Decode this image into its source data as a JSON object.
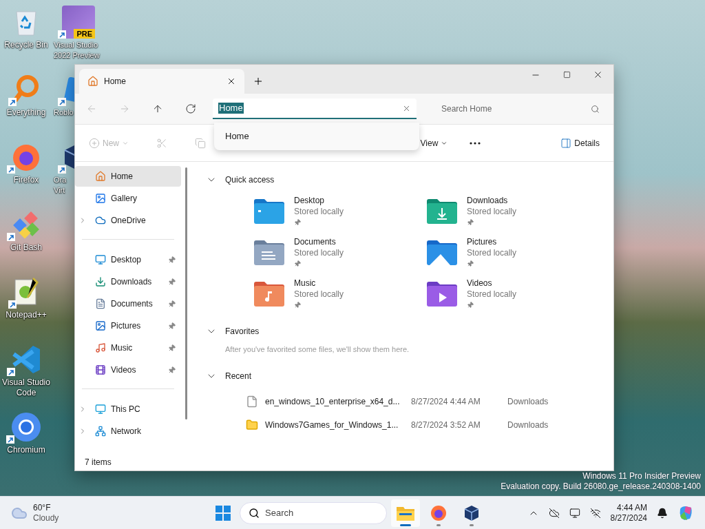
{
  "desktop_icons": [
    {
      "kind": "recycle",
      "lines": [
        "Recycle Bin"
      ],
      "shortcut": false
    },
    {
      "kind": "everything",
      "lines": [
        "Everything"
      ],
      "shortcut": true
    },
    {
      "kind": "firefox",
      "lines": [
        "Firefox"
      ],
      "shortcut": true
    },
    {
      "kind": "gitbash",
      "lines": [
        "Git Bash"
      ],
      "shortcut": true
    },
    {
      "kind": "notepad",
      "lines": [
        "Notepad++"
      ],
      "shortcut": true
    },
    {
      "kind": "vscode",
      "lines": [
        "Visual Studio",
        "Code"
      ],
      "shortcut": true
    },
    {
      "kind": "chromium",
      "lines": [
        "Chromium"
      ],
      "shortcut": true
    },
    {
      "kind": "vs",
      "lines": [
        "Visual Studio",
        "2022 Preview"
      ],
      "shortcut": true,
      "badge": "PRE"
    },
    {
      "kind": "roblox",
      "lines": [
        "Roblo"
      ],
      "shortcut": true
    },
    {
      "kind": "virtualbox",
      "lines": [
        "Ora",
        "Virt"
      ],
      "shortcut": true
    }
  ],
  "explorer": {
    "tab": {
      "title": "Home"
    },
    "nav": [
      {
        "kind": "back",
        "disabled": true
      },
      {
        "kind": "forward",
        "disabled": true
      },
      {
        "kind": "up",
        "disabled": false
      },
      {
        "kind": "refresh",
        "disabled": false
      }
    ],
    "address": {
      "value": "Home",
      "suggestions": [
        "Home"
      ]
    },
    "search": {
      "placeholder": "Search Home"
    },
    "toolbar": [
      {
        "kind": "new",
        "label": "New",
        "disabled": true
      },
      {
        "kind": "cut",
        "disabled": true
      },
      {
        "kind": "copy",
        "disabled": true
      },
      {
        "kind": "view",
        "label": "View",
        "disabled": false
      },
      {
        "kind": "more",
        "disabled": false
      },
      {
        "kind": "details",
        "label": "Details",
        "disabled": false
      }
    ],
    "sidebar": {
      "groups": [
        [
          {
            "kind": "home",
            "label": "Home",
            "selected": true,
            "pinned": false,
            "expandable": false
          },
          {
            "kind": "gallery",
            "label": "Gallery",
            "selected": false,
            "pinned": false,
            "expandable": false
          },
          {
            "kind": "onedrive",
            "label": "OneDrive",
            "selected": false,
            "pinned": false,
            "expandable": true
          }
        ],
        [
          {
            "kind": "desktop",
            "label": "Desktop",
            "selected": false,
            "pinned": true,
            "expandable": false
          },
          {
            "kind": "downloads",
            "label": "Downloads",
            "selected": false,
            "pinned": true,
            "expandable": false
          },
          {
            "kind": "documents",
            "label": "Documents",
            "selected": false,
            "pinned": true,
            "expandable": false
          },
          {
            "kind": "pictures",
            "label": "Pictures",
            "selected": false,
            "pinned": true,
            "expandable": false
          },
          {
            "kind": "music",
            "label": "Music",
            "selected": false,
            "pinned": true,
            "expandable": false
          },
          {
            "kind": "videos",
            "label": "Videos",
            "selected": false,
            "pinned": true,
            "expandable": false
          }
        ],
        [
          {
            "kind": "thispc",
            "label": "This PC",
            "selected": false,
            "pinned": false,
            "expandable": true
          },
          {
            "kind": "network",
            "label": "Network",
            "selected": false,
            "pinned": false,
            "expandable": true
          }
        ]
      ]
    },
    "quick_access": {
      "title": "Quick access",
      "expanded": true,
      "items": [
        {
          "kind": "desktop",
          "name": "Desktop",
          "status": "Stored locally",
          "pinned": true
        },
        {
          "kind": "downloads",
          "name": "Downloads",
          "status": "Stored locally",
          "pinned": true
        },
        {
          "kind": "documents",
          "name": "Documents",
          "status": "Stored locally",
          "pinned": true
        },
        {
          "kind": "pictures",
          "name": "Pictures",
          "status": "Stored locally",
          "pinned": true
        },
        {
          "kind": "music",
          "name": "Music",
          "status": "Stored locally",
          "pinned": true
        },
        {
          "kind": "videos",
          "name": "Videos",
          "status": "Stored locally",
          "pinned": true
        }
      ]
    },
    "favorites": {
      "title": "Favorites",
      "expanded": true,
      "hint": "After you've favorited some files, we'll show them here."
    },
    "recent": {
      "title": "Recent",
      "expanded": true,
      "files": [
        {
          "kind": "file",
          "name": "en_windows_10_enterprise_x64_d...",
          "date": "8/27/2024 4:44 AM",
          "location": "Downloads"
        },
        {
          "kind": "folder",
          "name": "Windows7Games_for_Windows_1...",
          "date": "8/27/2024 3:52 AM",
          "location": "Downloads"
        }
      ]
    },
    "status_bar": "7 items"
  },
  "watermark_notice": [
    "Windows 11 Pro Insider Preview",
    "Evaluation copy. Build 26080.ge_release.240308-1400"
  ],
  "taskbar": {
    "weather": {
      "temperature": "60°F",
      "condition": "Cloudy"
    },
    "search": {
      "placeholder": "Search"
    },
    "apps": [
      {
        "kind": "explorer",
        "active": true
      },
      {
        "kind": "firefox",
        "active": false
      },
      {
        "kind": "virtualbox",
        "active": false
      }
    ],
    "tray": [
      {
        "kind": "chevron"
      },
      {
        "kind": "onedrive-off"
      },
      {
        "kind": "display"
      },
      {
        "kind": "network-off"
      }
    ],
    "time": "4:44 AM",
    "date": "8/27/2024"
  }
}
